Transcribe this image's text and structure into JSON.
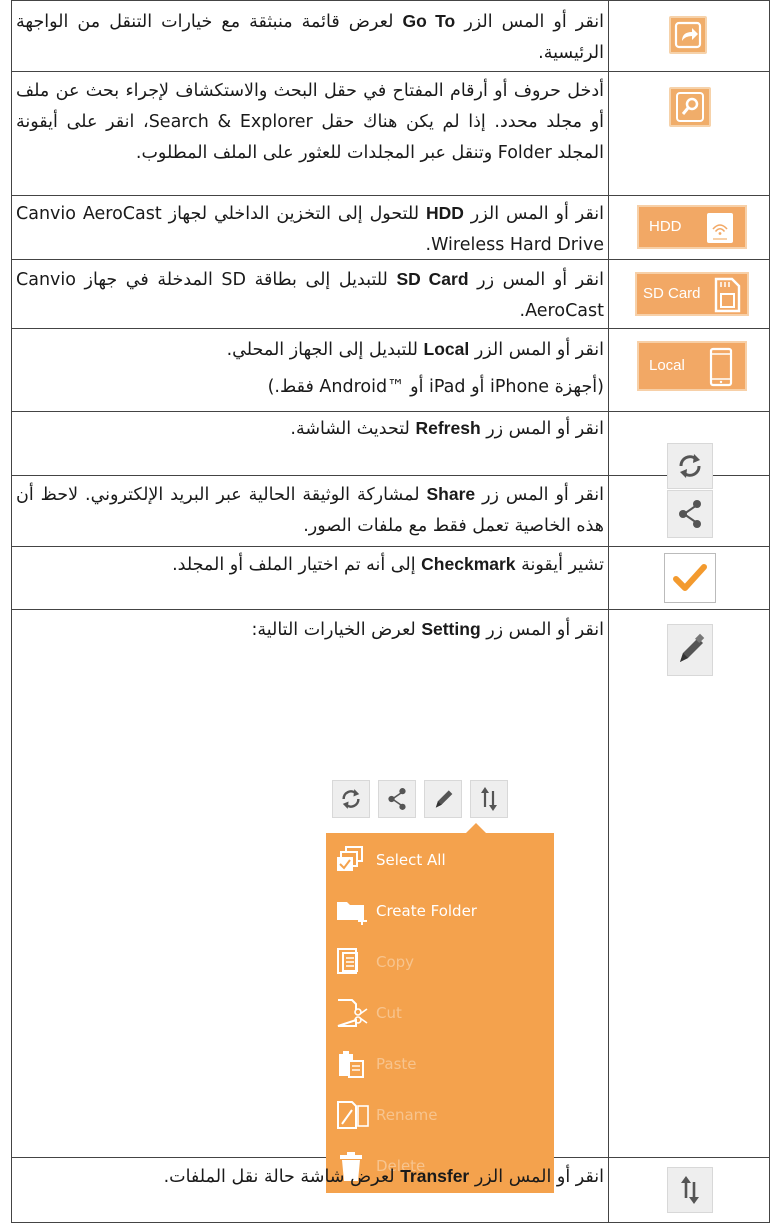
{
  "colors": {
    "accent": "#f2a865",
    "accent_light": "#f7d0a8",
    "menu_bg": "#f4a24d",
    "check": "#f39a2e",
    "icon_gray": "#555555"
  },
  "rows": [
    {
      "icon": "go-to-arrow-icon",
      "text": {
        "before": "انقر أو المس الزر",
        "bold": "Go To",
        "after": "لعرض قائمة منبثقة مع خيارات التنقل من الواجهة الرئيسية."
      }
    },
    {
      "icon": "search-magnifier-icon",
      "text": {
        "full": "أدخل حروف أو أرقام المفتاح في حقل البحث والاستكشاف لإجراء بحث عن ملف أو مجلد محدد. إذا لم يكن هناك حقل Search & Explorer، انقر على أيقونة المجلد Folder وتنقل عبر المجلدات للعثور على الملف المطلوب."
      }
    },
    {
      "icon": "hdd-wireless-icon",
      "button_label": "HDD",
      "text": {
        "before": "انقر أو المس الزر",
        "bold": "HDD",
        "after": "للتحول إلى التخزين الداخلي لجهاز Canvio AeroCast Wireless Hard Drive."
      }
    },
    {
      "icon": "sd-card-icon",
      "button_label": "SD Card",
      "text": {
        "before": "انقر أو المس زر",
        "bold": "SD Card",
        "after": "للتبديل إلى بطاقة SD المدخلة في جهاز Canvio AeroCast."
      }
    },
    {
      "icon": "phone-icon",
      "button_label": "Local",
      "text": {
        "before": "انقر أو المس الزر",
        "bold": "Local",
        "after": "للتبديل إلى الجهاز المحلي.",
        "line2": "(أجهزة iPhone أو iPad أو ™Android فقط.)"
      }
    },
    {
      "icon": "refresh-icon",
      "text": {
        "before": "انقر أو المس زر",
        "bold": "Refresh",
        "after": "لتحديث الشاشة."
      }
    },
    {
      "icon": "share-icon",
      "text": {
        "before": "انقر أو المس زر",
        "bold": "Share",
        "after": "لمشاركة الوثيقة الحالية عبر البريد الإلكتروني. لاحظ أن هذه الخاصية تعمل فقط مع ملفات الصور."
      }
    },
    {
      "icon": "checkmark-icon",
      "text": {
        "before": "تشير أيقونة",
        "bold": "Checkmark",
        "after": "إلى أنه تم اختيار الملف أو المجلد."
      }
    },
    {
      "icon": "pencil-setting-icon",
      "text": {
        "before": "انقر أو المس زر",
        "bold": "Setting",
        "after": "لعرض الخيارات التالية:"
      }
    },
    {
      "icon": "transfer-arrows-icon",
      "text": {
        "before": "انقر أو المس الزر",
        "bold": "Transfer",
        "after": "لعرض شاشة حالة نقل الملفات."
      }
    }
  ],
  "setting_menu": {
    "toolbar_icons": [
      "refresh-icon",
      "share-icon",
      "pencil-icon",
      "transfer-icon"
    ],
    "items": [
      {
        "label": "Select All",
        "icon": "select-all-icon",
        "enabled": true
      },
      {
        "label": "Create Folder",
        "icon": "create-folder-icon",
        "enabled": true
      },
      {
        "label": "Copy",
        "icon": "copy-icon",
        "enabled": false
      },
      {
        "label": "Cut",
        "icon": "cut-icon",
        "enabled": false
      },
      {
        "label": "Paste",
        "icon": "paste-icon",
        "enabled": false
      },
      {
        "label": "Rename",
        "icon": "rename-icon",
        "enabled": false
      },
      {
        "label": "Delete",
        "icon": "delete-icon",
        "enabled": false
      }
    ]
  }
}
